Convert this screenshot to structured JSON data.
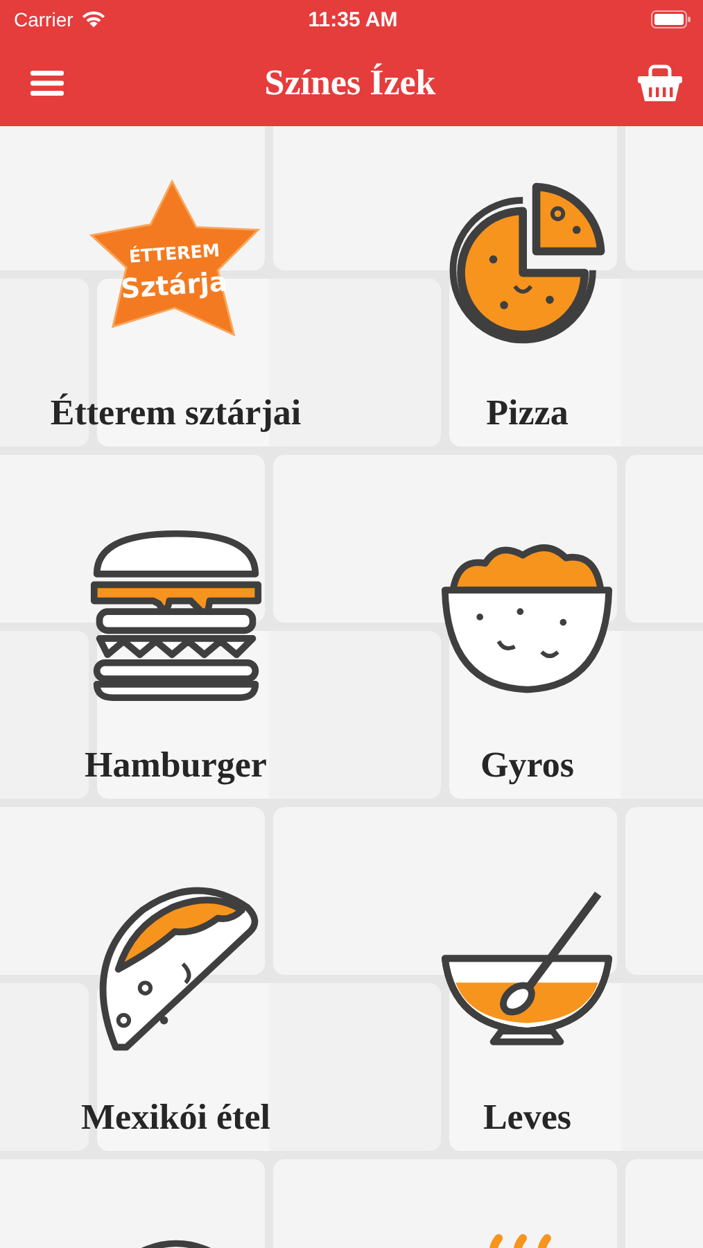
{
  "status_bar": {
    "carrier": "Carrier",
    "time": "11:35 AM"
  },
  "nav_bar": {
    "title": "Színes Ízek"
  },
  "categories": [
    {
      "kind": "star-logo",
      "logo_text": [
        "ÉTTEREM",
        "Sztárja"
      ],
      "label": "Étterem sztárjai"
    },
    {
      "kind": "pizza",
      "label": "Pizza"
    },
    {
      "kind": "burger",
      "label": "Hamburger"
    },
    {
      "kind": "bowl",
      "label": "Gyros"
    },
    {
      "kind": "taco",
      "label": "Mexikói étel"
    },
    {
      "kind": "soup",
      "label": "Leves"
    },
    {
      "kind": "plate"
    },
    {
      "kind": "steam"
    }
  ]
}
